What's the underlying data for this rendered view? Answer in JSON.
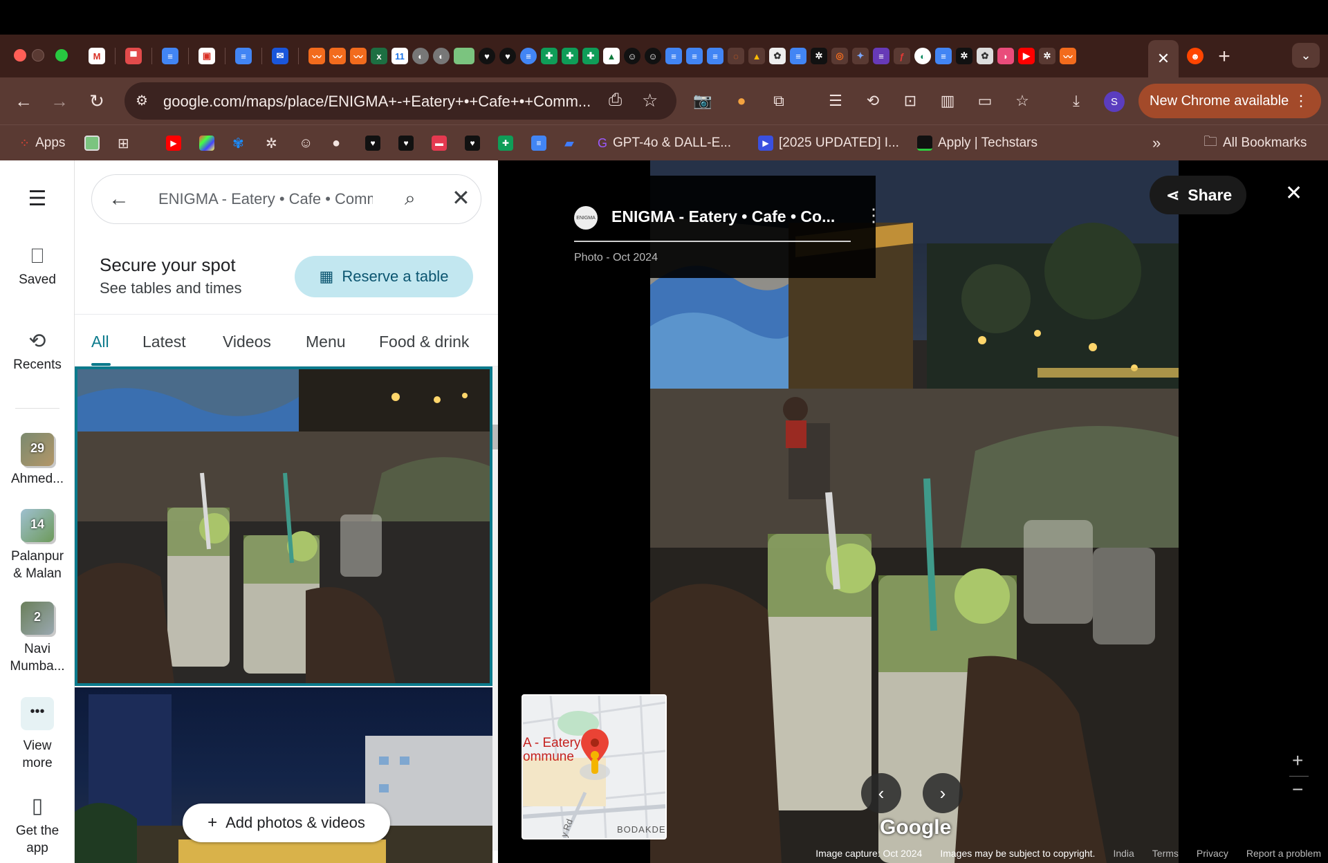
{
  "tabs": {
    "close_glyph": "✕",
    "new_tab_glyph": "+",
    "tab_search_glyph": "⌄"
  },
  "toolbar": {
    "url": "google.com/maps/place/ENIGMA+-+Eatery+•+Cafe+•+Comm...",
    "profile_initial": "S",
    "new_chrome_label": "New Chrome available"
  },
  "bookmarks": {
    "apps_label": "Apps",
    "gpt_label": "GPT-4o & DALL-E...",
    "updated_label": "[2025 UPDATED] I...",
    "techstars_label": "Apply | Techstars",
    "all_bookmarks_label": "All Bookmarks"
  },
  "rail": {
    "saved_label": "Saved",
    "recents_label": "Recents",
    "trips": [
      {
        "count": "29",
        "label": "Ahmed..."
      },
      {
        "count": "14",
        "label": "Palanpur & Malan"
      },
      {
        "count": "2",
        "label": "Navi Mumba..."
      }
    ],
    "view_more_label": "View more",
    "get_app_label": "Get the app"
  },
  "panel": {
    "search_value": "ENIGMA - Eatery • Cafe • Commune",
    "reserve_heading": "Secure your spot",
    "reserve_sub": "See tables and times",
    "reserve_button": "Reserve a table",
    "tabs": [
      "All",
      "Latest",
      "Videos",
      "Menu",
      "Food & drink"
    ],
    "add_photos_label": "Add photos & videos"
  },
  "viewer": {
    "place_name": "ENIGMA - Eatery • Cafe • Co...",
    "logo_text": "ENIGMA",
    "photo_meta": "Photo - Oct 2024",
    "share_label": "Share",
    "google_logo": "Google",
    "map_label_line1": "A - Eatery",
    "map_label_line2": "ommune",
    "map_road_label": "BODAKDE",
    "map_road2_label": "y Rd",
    "footer": {
      "capture": "Image capture: Oct 2024",
      "copyright": "Images may be subject to copyright.",
      "country": "India",
      "terms": "Terms",
      "privacy": "Privacy",
      "report": "Report a problem"
    }
  }
}
